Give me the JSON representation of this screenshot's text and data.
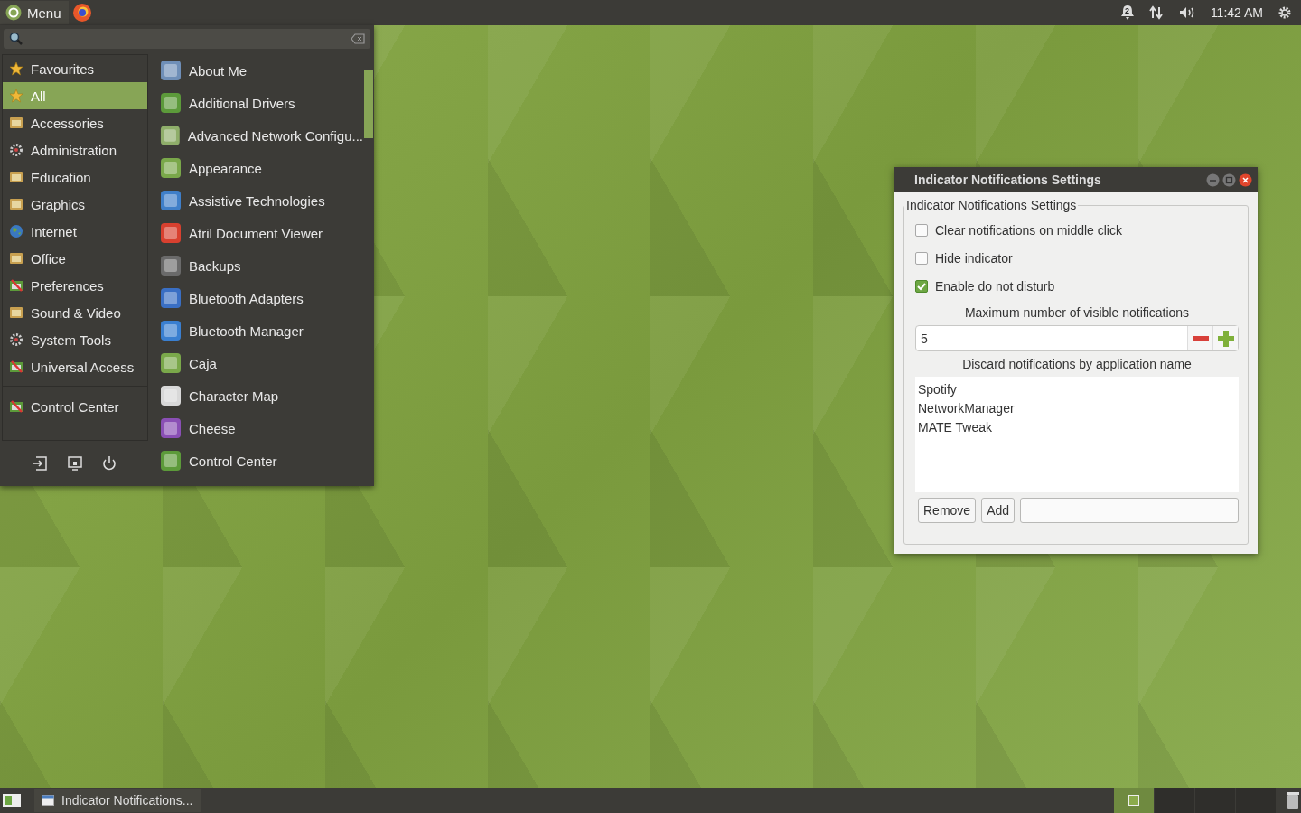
{
  "top_panel": {
    "menu_label": "Menu",
    "notification_count": "2",
    "clock": "11:42 AM"
  },
  "menu": {
    "categories": [
      {
        "label": "Favourites",
        "kind": "star",
        "selected": false
      },
      {
        "label": "All",
        "kind": "star",
        "selected": true
      },
      {
        "label": "Accessories",
        "kind": "category",
        "selected": false
      },
      {
        "label": "Administration",
        "kind": "gear",
        "selected": false
      },
      {
        "label": "Education",
        "kind": "category",
        "selected": false
      },
      {
        "label": "Graphics",
        "kind": "category",
        "selected": false
      },
      {
        "label": "Internet",
        "kind": "globe",
        "selected": false
      },
      {
        "label": "Office",
        "kind": "category",
        "selected": false
      },
      {
        "label": "Preferences",
        "kind": "tool",
        "selected": false
      },
      {
        "label": "Sound & Video",
        "kind": "category",
        "selected": false
      },
      {
        "label": "System Tools",
        "kind": "gear",
        "selected": false
      },
      {
        "label": "Universal Access",
        "kind": "tool",
        "selected": false
      }
    ],
    "places": [
      {
        "label": "Control Center",
        "kind": "tool"
      }
    ],
    "apps": [
      {
        "label": "About Me",
        "color": "#6f8fb8"
      },
      {
        "label": "Additional Drivers",
        "color": "#5c9a3a"
      },
      {
        "label": "Advanced Network Configu...",
        "color": "#8fae6a"
      },
      {
        "label": "Appearance",
        "color": "#7aa84a"
      },
      {
        "label": "Assistive Technologies",
        "color": "#3f7fc9"
      },
      {
        "label": "Atril Document Viewer",
        "color": "#d8402f"
      },
      {
        "label": "Backups",
        "color": "#6a6a6a"
      },
      {
        "label": "Bluetooth Adapters",
        "color": "#3a6fc4"
      },
      {
        "label": "Bluetooth Manager",
        "color": "#3a7fd0"
      },
      {
        "label": "Caja",
        "color": "#7aa84a"
      },
      {
        "label": "Character Map",
        "color": "#d8d8d8"
      },
      {
        "label": "Cheese",
        "color": "#8a4fb5"
      },
      {
        "label": "Control Center",
        "color": "#5c9a3a"
      }
    ]
  },
  "dialog": {
    "title": "Indicator Notifications Settings",
    "frame_label": "Indicator Notifications Settings",
    "options": [
      {
        "label": "Clear notifications on middle click",
        "checked": false
      },
      {
        "label": "Hide indicator",
        "checked": false
      },
      {
        "label": "Enable do not disturb",
        "checked": true
      }
    ],
    "max_label": "Maximum number of visible notifications",
    "max_value": "5",
    "discard_label": "Discard notifications by application name",
    "apps": [
      "Spotify",
      "NetworkManager",
      "MATE Tweak"
    ],
    "buttons": [
      "Remove",
      "Add"
    ]
  },
  "taskbar": {
    "tasks": [
      {
        "label": "Indicator Notifications..."
      }
    ],
    "workspaces": [
      {
        "selected": true
      },
      {
        "selected": false
      },
      {
        "selected": false
      },
      {
        "selected": false
      }
    ]
  }
}
